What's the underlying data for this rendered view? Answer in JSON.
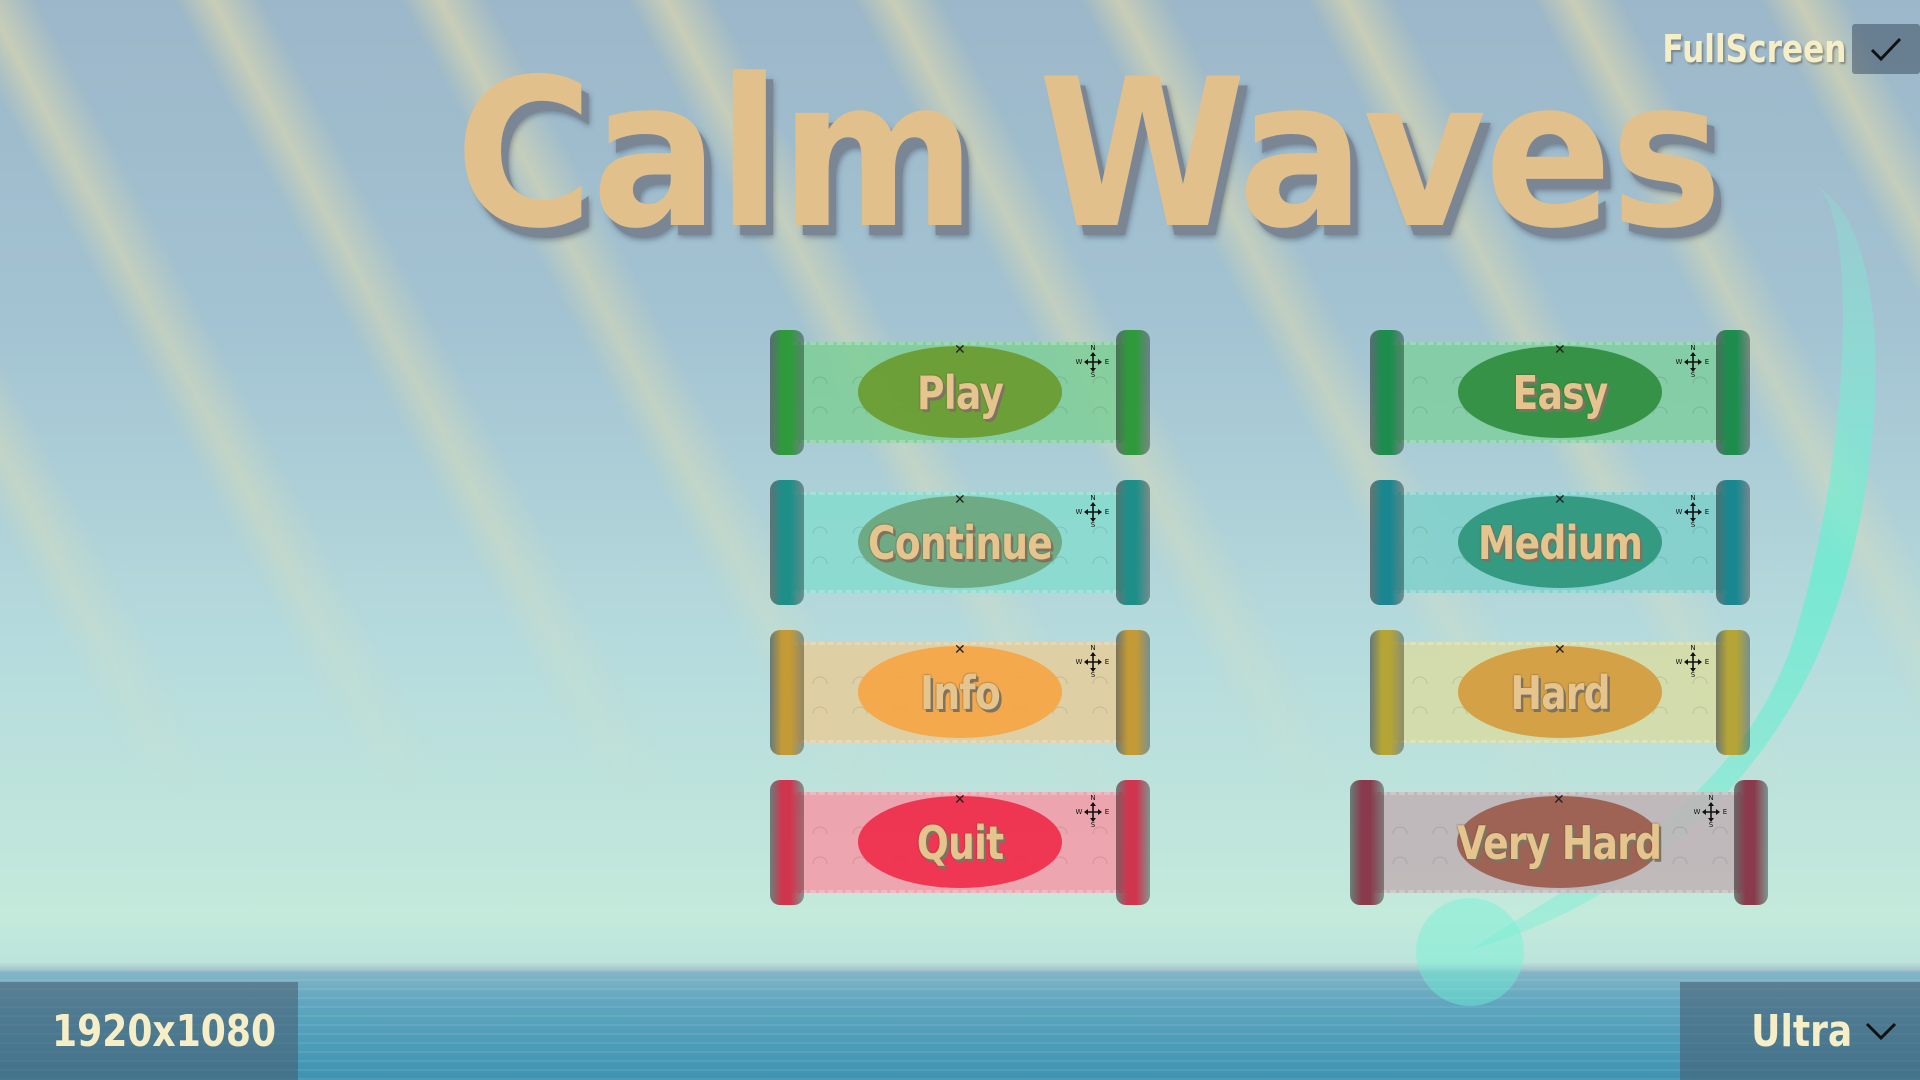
{
  "title": "Calm Waves",
  "fullscreen": {
    "label": "FullScreen",
    "checked": true
  },
  "menu": {
    "main": [
      {
        "id": "play",
        "label": "Play",
        "roller": "#2f9a3c",
        "paper": "#7fcf98",
        "oval": "#6a9a2c"
      },
      {
        "id": "continue",
        "label": "Continue",
        "roller": "#1e8f88",
        "paper": "#86dccf",
        "oval": "#6aa47a"
      },
      {
        "id": "info",
        "label": "Info",
        "roller": "#c39a36",
        "paper": "#e6cd9b",
        "oval": "#f6a444"
      },
      {
        "id": "quit",
        "label": "Quit",
        "roller": "#d0354e",
        "paper": "#f59aa8",
        "oval": "#ee2a48"
      }
    ],
    "difficulty": [
      {
        "id": "easy",
        "label": "Easy",
        "roller": "#1c8d4c",
        "paper": "#7fcfa0",
        "oval": "#2d8c3c"
      },
      {
        "id": "medium",
        "label": "Medium",
        "roller": "#1a8790",
        "paper": "#7fd0cc",
        "oval": "#2b957a"
      },
      {
        "id": "hard",
        "label": "Hard",
        "roller": "#b5a537",
        "paper": "#d8dca4",
        "oval": "#d59a3b"
      },
      {
        "id": "very-hard",
        "label": "Very Hard",
        "roller": "#8a3a4a",
        "paper": "#c0b2b6",
        "oval": "#9a5a4a"
      }
    ]
  },
  "resolution": {
    "value": "1920x1080"
  },
  "quality": {
    "value": "Ultra"
  },
  "icons": {
    "check": "check-icon",
    "chevron": "chevron-down-icon",
    "compass": "compass-icon"
  }
}
